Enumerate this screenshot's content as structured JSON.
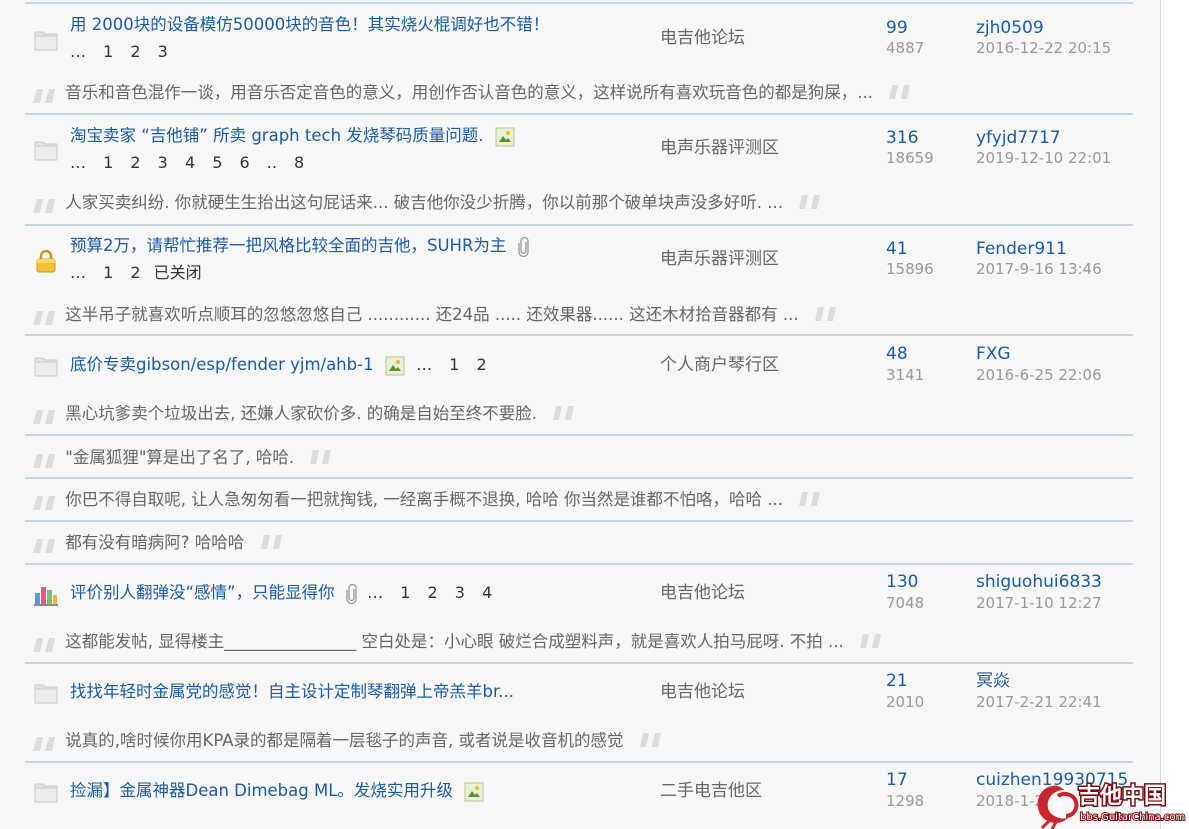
{
  "threads": [
    {
      "icon": "folder-icon",
      "title": "用 2000块的设备模仿50000块的音色！其实烧火棍调好也不错！",
      "attachment": false,
      "image": false,
      "pages": [
        "…",
        "1",
        "2",
        "3"
      ],
      "closed": "",
      "forum": "电吉他论坛",
      "replies": "99",
      "views": "4887",
      "author": "zjh0509",
      "date": "2016-12-22 20:15",
      "quotes": [
        "音乐和音色混作一谈，用音乐否定音色的意义，用创作否认音色的意义，这样说所有喜欢玩音色的都是狗屎，..."
      ]
    },
    {
      "icon": "folder-icon",
      "title": "淘宝卖家 “吉他铺” 所卖 graph tech 发烧琴码质量问题.",
      "attachment": false,
      "image": true,
      "pages": [
        "…",
        "1",
        "2",
        "3",
        "4",
        "5",
        "6",
        "..",
        "8"
      ],
      "closed": "",
      "forum": "电声乐器评测区",
      "replies": "316",
      "views": "18659",
      "author": "yfyjd7717",
      "date": "2019-12-10 22:01",
      "quotes": [
        "人家买卖纠纷. 你就硬生生抬出这句屁话来... 破吉他你没少折腾，你以前那个破单块声没多好听. ..."
      ]
    },
    {
      "icon": "lock-icon",
      "title": "预算2万，请帮忙推荐一把风格比较全面的吉他，SUHR为主",
      "attachment": true,
      "image": false,
      "pages": [
        "…",
        "1",
        "2"
      ],
      "closed": "已关闭",
      "forum": "电声乐器评测区",
      "replies": "41",
      "views": "15896",
      "author": "Fender911",
      "date": "2017-9-16 13:46",
      "quotes": [
        "这半吊子就喜欢听点顺耳的忽悠忽悠自己 ............ 还24品 ..... 还效果器...... 这还木材拾音器都有 ..."
      ]
    },
    {
      "icon": "folder-icon",
      "title": "底价专卖gibson/esp/fender yjm/ahb-1",
      "attachment": false,
      "image": true,
      "inline_pages": [
        "…",
        "1",
        "2"
      ],
      "closed": "",
      "forum": "个人商户琴行区",
      "replies": "48",
      "views": "3141",
      "author": "FXG",
      "date": "2016-6-25 22:06",
      "quotes": [
        "黑心坑爹卖个垃圾出去, 还嫌人家砍价多. 的确是自始至终不要脸.",
        "\"金属狐狸\"算是出了名了, 哈哈.",
        "你巴不得自取呢, 让人急匆匆看一把就掏钱, 一经离手概不退换, 哈哈 你当然是谁都不怕咯，哈哈 ...",
        "都有没有暗病阿? 哈哈哈"
      ]
    },
    {
      "icon": "poll-icon",
      "title": "评价别人翻弹没“感情”，只能显得你",
      "attachment": true,
      "image": false,
      "inline_pages": [
        "…",
        "1",
        "2",
        "3",
        "4"
      ],
      "closed": "",
      "forum": "电吉他论坛",
      "replies": "130",
      "views": "7048",
      "author": "shiguohui6833",
      "date": "2017-1-10 12:27",
      "quotes": [
        "这都能发帖, 显得楼主________________ 空白处是：小心眼 破烂合成塑料声，就是喜欢人拍马屁呀. 不拍 ..."
      ]
    },
    {
      "icon": "folder-icon",
      "title": "找找年轻时金属党的感觉！自主设计定制琴翻弹上帝羔羊br...",
      "attachment": false,
      "image": false,
      "closed": "",
      "forum": "电吉他论坛",
      "replies": "21",
      "views": "2010",
      "author": "冥焱",
      "date": "2017-2-21 22:41",
      "quotes": [
        "说真的,啥时候你用KPA录的都是隔着一层毯子的声音, 或者说是收音机的感觉"
      ]
    },
    {
      "icon": "folder-icon",
      "title": "捡漏】金属神器Dean Dimebag ML。发烧实用升级",
      "attachment": false,
      "image": true,
      "closed": "",
      "forum": "二手电吉他区",
      "replies": "17",
      "views": "1298",
      "author": "cuizhen19930715",
      "date": "2018-1-2",
      "quotes": []
    }
  ],
  "watermark": {
    "brand": "吉他中国",
    "url": "bbs.GuitarChina.com"
  },
  "colors": {
    "link": "#1a5aa6",
    "muted": "#999999",
    "divider": "#c5d4e0",
    "bg": "#f7f7f7"
  }
}
